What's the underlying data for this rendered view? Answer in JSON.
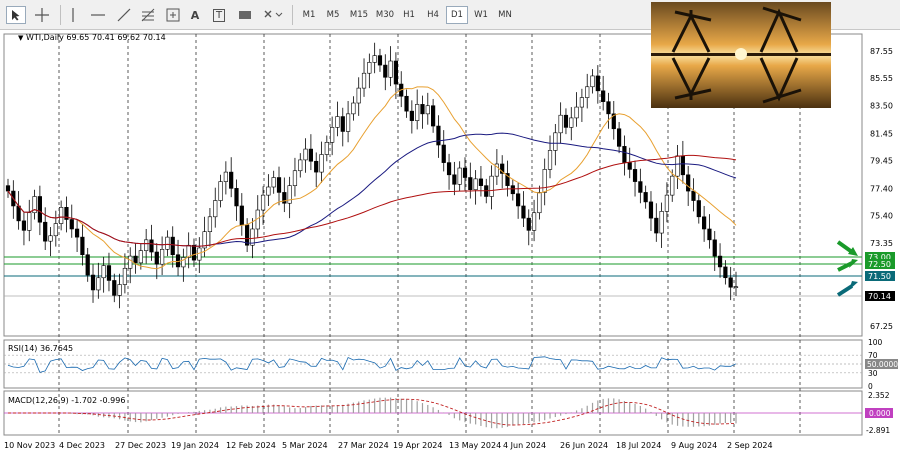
{
  "toolbar": {
    "timeframes": [
      "M1",
      "M5",
      "M15",
      "M30",
      "H1",
      "H4",
      "D1",
      "W1",
      "MN"
    ],
    "active_timeframe": "D1",
    "tools": [
      "cursor-icon",
      "crosshair-icon",
      "hline-icon",
      "trendline-icon",
      "fib-icon",
      "text-icon",
      "label-icon",
      "rectangle-icon",
      "shapes-icon"
    ],
    "text_tool": "A",
    "label_tool": "T"
  },
  "chart": {
    "symbol_info": "WTI,Daily  69.65 70.41 69.62 70.14",
    "price_axis": [
      "87.55",
      "85.55",
      "83.50",
      "81.45",
      "79.45",
      "77.40",
      "75.40",
      "73.35",
      "69.30",
      "67.25"
    ],
    "date_axis": [
      "10 Nov 2023",
      "4 Dec 2023",
      "27 Dec 2023",
      "19 Jan 2024",
      "12 Feb 2024",
      "5 Mar 2024",
      "27 Mar 2024",
      "19 Apr 2024",
      "13 May 2024",
      "4 Jun 2024",
      "26 Jun 2024",
      "18 Jul 2024",
      "9 Aug 2024",
      "2 Sep 2024"
    ],
    "levels": [
      {
        "label": "73.00",
        "color": "#1a9a2a",
        "bg": "#1a9a2a"
      },
      {
        "label": "72.50",
        "color": "#1a9a2a",
        "bg": "#1a9a2a"
      },
      {
        "label": "71.50",
        "color": "#0a6a78",
        "bg": "#0a6a78"
      }
    ],
    "current_price": "70.14",
    "colors": {
      "ma_short": "#e8a030",
      "ma_mid": "#1a1a80",
      "ma_long": "#b01010",
      "candle": "#000000"
    }
  },
  "chart_data": {
    "type": "candlestick",
    "series_close": [
      77.2,
      76.1,
      75.0,
      74.3,
      75.6,
      76.8,
      74.9,
      73.5,
      73.9,
      74.8,
      76.0,
      75.1,
      74.4,
      73.8,
      72.5,
      71.0,
      69.9,
      70.8,
      71.7,
      70.6,
      69.5,
      70.3,
      71.5,
      72.4,
      71.9,
      72.8,
      73.6,
      72.7,
      71.8,
      72.9,
      73.8,
      72.5,
      71.6,
      72.3,
      73.2,
      72.1,
      73.0,
      74.2,
      75.3,
      76.5,
      77.9,
      78.6,
      77.4,
      76.1,
      74.7,
      73.2,
      74.4,
      75.8,
      76.9,
      77.5,
      78.2,
      77.1,
      76.3,
      77.6,
      78.7,
      79.5,
      80.3,
      79.4,
      78.6,
      79.9,
      80.8,
      81.9,
      82.7,
      81.6,
      82.9,
      83.7,
      84.8,
      85.9,
      86.7,
      87.2,
      86.5,
      85.6,
      86.8,
      85.1,
      84.2,
      83.1,
      82.4,
      83.6,
      82.9,
      83.5,
      82.0,
      80.6,
      79.3,
      78.4,
      77.7,
      78.9,
      78.2,
      77.3,
      78.1,
      77.6,
      76.8,
      78.3,
      79.2,
      78.5,
      77.6,
      77.0,
      76.1,
      75.2,
      74.3,
      75.6,
      77.1,
      78.8,
      80.2,
      81.5,
      82.8,
      81.9,
      82.6,
      83.4,
      84.1,
      84.9,
      85.7,
      84.6,
      83.8,
      82.9,
      81.8,
      80.5,
      79.3,
      78.8,
      77.9,
      77.1,
      76.4,
      75.2,
      74.1,
      75.7,
      76.9,
      78.3,
      79.8,
      78.4,
      77.2,
      76.5,
      75.3,
      74.4,
      73.6,
      72.4,
      71.6,
      70.8,
      70.1,
      70.14
    ],
    "rsi": {
      "label": "RSI(14) 36.7645",
      "levels": [
        "100",
        "70",
        "50.0000",
        "30",
        "0"
      ]
    },
    "macd": {
      "label": "MACD(12,26,9) -1.702 -0.996",
      "levels": [
        "2.352",
        "0.000",
        "-2.891"
      ]
    }
  }
}
